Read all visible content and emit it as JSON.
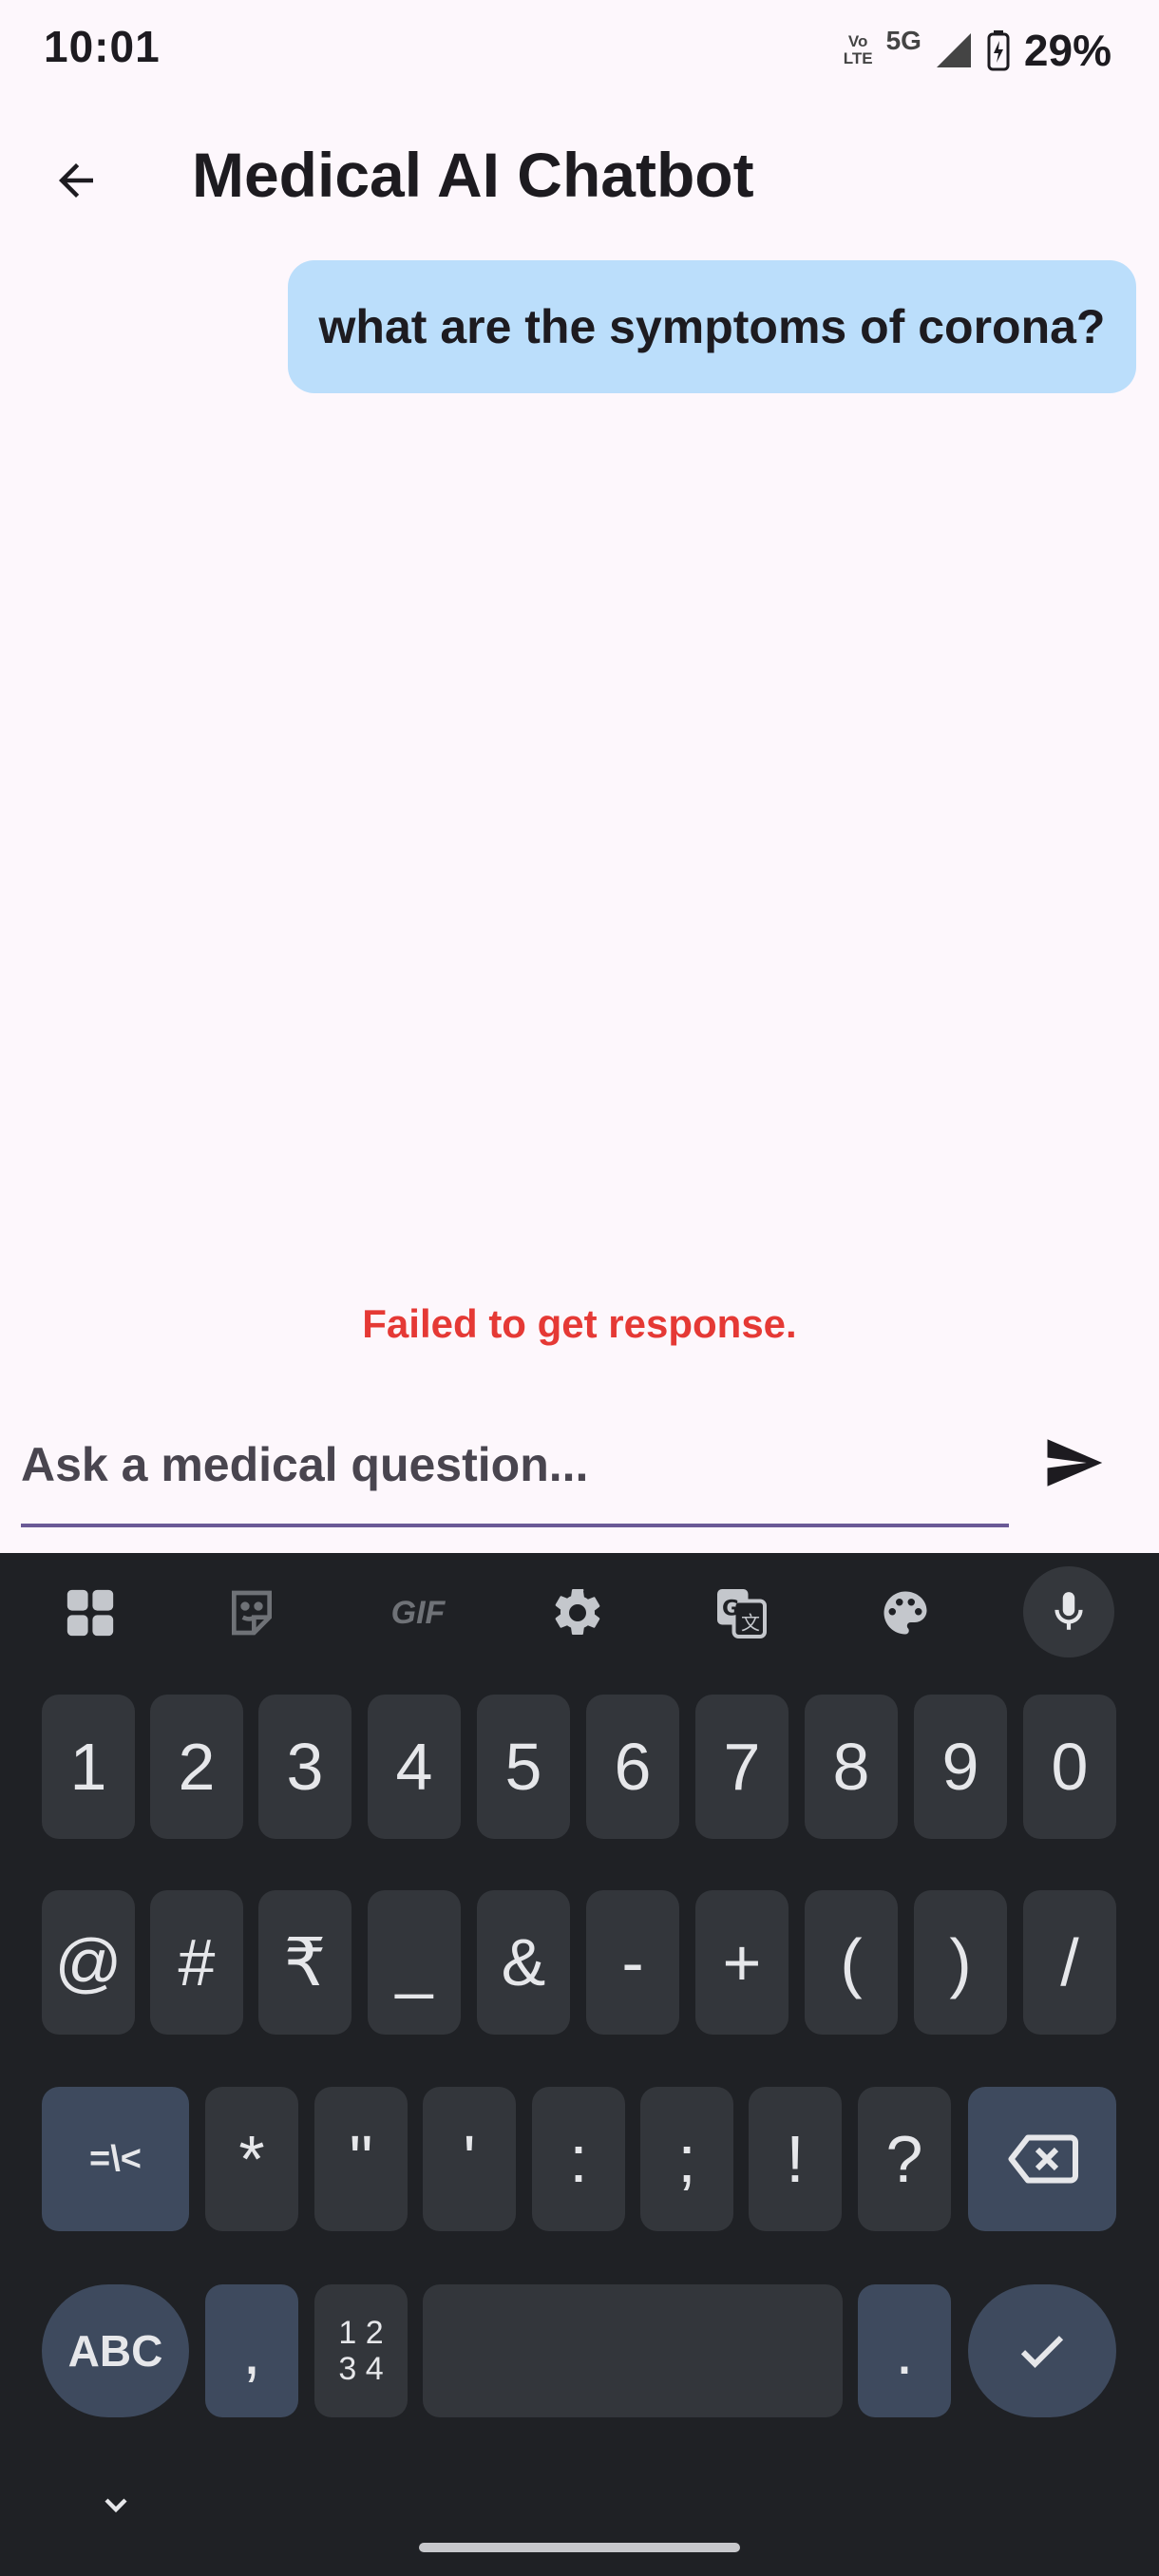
{
  "status_bar": {
    "time": "10:01",
    "volte_top": "Vo",
    "volte_bottom": "LTE",
    "network": "5G",
    "battery": "29%"
  },
  "app_bar": {
    "title": "Medical AI Chatbot"
  },
  "messages": [
    {
      "role": "user",
      "text": "what are the symptoms of corona?"
    }
  ],
  "error_text": "Failed to get response.",
  "input": {
    "placeholder": "Ask a medical question...",
    "value": ""
  },
  "keyboard": {
    "toolbar": [
      "apps-icon",
      "sticker-icon",
      "GIF",
      "settings-icon",
      "translate-icon",
      "palette-icon",
      "mic-icon"
    ],
    "row1": [
      "1",
      "2",
      "3",
      "4",
      "5",
      "6",
      "7",
      "8",
      "9",
      "0"
    ],
    "row2": [
      "@",
      "#",
      "₹",
      "_",
      "&",
      "-",
      "+",
      "(",
      ")",
      "/"
    ],
    "row3": [
      "=\\<",
      "*",
      "\"",
      "'",
      ":",
      ";",
      "!",
      "?"
    ],
    "row4": {
      "abc": "ABC",
      "comma": ",",
      "num_top": "1 2",
      "num_bottom": "3 4",
      "period": "."
    }
  }
}
